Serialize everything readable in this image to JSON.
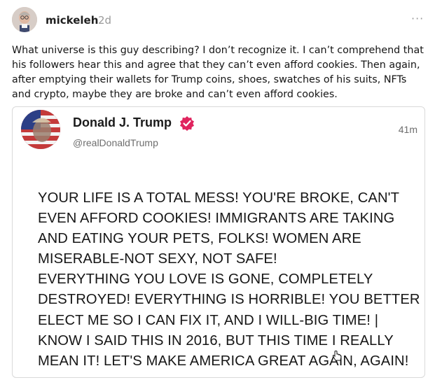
{
  "post": {
    "username": "mickeleh",
    "time": "2d",
    "more_label": "···",
    "text": "What universe is this guy describing? I don’t recognize it. I can’t comprehend that his followers hear this and agree that they can’t even afford cookies. Then again, after emptying their wallets for Trump coins, shoes, swatches of his suits, NFTs and crypto, maybe they are broke and can’t even afford cookies."
  },
  "embed": {
    "name": "Donald J. Trump",
    "handle": "@realDonaldTrump",
    "time": "41m",
    "verified_color": "#e0245e",
    "lines": [
      "YOUR LIFE IS A TOTAL MESS! YOU'RE BROKE, CAN'T",
      "EVEN AFFORD COOKIES! IMMIGRANTS ARE TAKING",
      "AND EATING YOUR PETS, FOLKS! WOMEN ARE",
      "MISERABLE-NOT SEXY, NOT SAFE!",
      "EVERYTHING YOU LOVE IS GONE, COMPLETELY",
      "DESTROYED! EVERYTHING IS HORRIBLE! YOU BETTER",
      "ELECT ME SO I CAN FIX IT, AND I WILL-BIG TIME! |",
      "KNOW I SAID THIS IN 2016, BUT THIS TIME I REALLY",
      "MEAN IT! LET'S MAKE AMERICA GREAT AGAIN, AGAIN!"
    ]
  },
  "icons": {
    "more": "more-horizontal-icon",
    "verified": "verified-badge-icon",
    "cursor": "hand-cursor-icon"
  }
}
